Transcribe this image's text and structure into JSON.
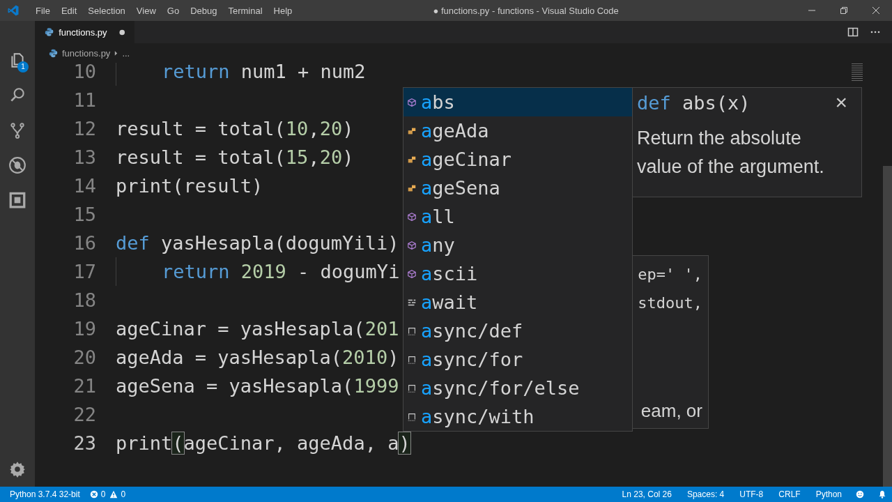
{
  "window": {
    "title": "● functions.py - functions - Visual Studio Code"
  },
  "menu": [
    "File",
    "Edit",
    "Selection",
    "View",
    "Go",
    "Debug",
    "Terminal",
    "Help"
  ],
  "activity_bar": {
    "explorer_badge": "1"
  },
  "tabs": [
    {
      "label": "functions.py",
      "selected": true,
      "modified": true
    }
  ],
  "breadcrumb": [
    "functions.py",
    "..."
  ],
  "editor": {
    "lines": [
      {
        "number": "10",
        "indent": true,
        "current": false,
        "tokens": [
          {
            "text": "return",
            "kind": "keyword"
          },
          {
            "text": " num1 + num2",
            "kind": "plain"
          }
        ]
      },
      {
        "number": "11",
        "current": false
      },
      {
        "number": "12",
        "indent": false,
        "current": false,
        "tokens": [
          {
            "text": "result = total(",
            "kind": "plain"
          },
          {
            "text": "10",
            "kind": "number"
          },
          {
            "text": ",",
            "kind": "plain"
          },
          {
            "text": "20",
            "kind": "number"
          },
          {
            "text": ")",
            "kind": "plain"
          }
        ]
      },
      {
        "number": "13",
        "indent": false,
        "current": false,
        "tokens": [
          {
            "text": "result = total(",
            "kind": "plain"
          },
          {
            "text": "15",
            "kind": "number"
          },
          {
            "text": ",",
            "kind": "plain"
          },
          {
            "text": "20",
            "kind": "number"
          },
          {
            "text": ")",
            "kind": "plain"
          }
        ]
      },
      {
        "number": "14",
        "indent": false,
        "current": false,
        "tokens": [
          {
            "text": "print(result)",
            "kind": "plain"
          }
        ]
      },
      {
        "number": "15",
        "current": false
      },
      {
        "number": "16",
        "indent": false,
        "current": false,
        "tokens": [
          {
            "text": "def",
            "kind": "keyword"
          },
          {
            "text": " yasHesapla(dogumYili)",
            "kind": "plain"
          }
        ]
      },
      {
        "number": "17",
        "indent": true,
        "current": false,
        "tokens": [
          {
            "text": "return",
            "kind": "keyword"
          },
          {
            "text": " 2019",
            "kind": "number"
          },
          {
            "text": " - dogumYi",
            "kind": "plain"
          }
        ]
      },
      {
        "number": "18",
        "current": false
      },
      {
        "number": "19",
        "indent": false,
        "current": false,
        "tokens": [
          {
            "text": "ageCinar = yasHesapla(",
            "kind": "plain"
          },
          {
            "text": "201",
            "kind": "number"
          }
        ]
      },
      {
        "number": "20",
        "indent": false,
        "current": false,
        "tokens": [
          {
            "text": "ageAda = yasHesapla(",
            "kind": "plain"
          },
          {
            "text": "2010",
            "kind": "number"
          },
          {
            "text": ")",
            "kind": "plain"
          }
        ]
      },
      {
        "number": "21",
        "indent": false,
        "current": false,
        "tokens": [
          {
            "text": "ageSena = yasHesapla(",
            "kind": "plain"
          },
          {
            "text": "1999",
            "kind": "number"
          }
        ]
      },
      {
        "number": "22",
        "current": false
      },
      {
        "number": "23",
        "indent": false,
        "current": true,
        "tokens": [
          {
            "text": "print",
            "kind": "plain"
          },
          {
            "text": "(",
            "kind": "bracket-match"
          },
          {
            "text": "ageCinar, ageAda, a",
            "kind": "plain"
          },
          {
            "text": ")",
            "kind": "bracket-match"
          }
        ]
      }
    ]
  },
  "suggestions": [
    {
      "label": "abs",
      "kind": "function",
      "selected": true
    },
    {
      "label": "ageAda",
      "kind": "variable",
      "selected": false
    },
    {
      "label": "ageCinar",
      "kind": "variable",
      "selected": false
    },
    {
      "label": "ageSena",
      "kind": "variable",
      "selected": false
    },
    {
      "label": "all",
      "kind": "function",
      "selected": false
    },
    {
      "label": "any",
      "kind": "function",
      "selected": false
    },
    {
      "label": "ascii",
      "kind": "function",
      "selected": false
    },
    {
      "label": "await",
      "kind": "keyword",
      "selected": false
    },
    {
      "label": "async/def",
      "kind": "snippet",
      "selected": false
    },
    {
      "label": "async/for",
      "kind": "snippet",
      "selected": false
    },
    {
      "label": "async/for/else",
      "kind": "snippet",
      "selected": false
    },
    {
      "label": "async/with",
      "kind": "snippet",
      "selected": false
    }
  ],
  "doc": {
    "keyword": "def",
    "signature": "abs(x)",
    "close": "×",
    "text": "Return the absolute value of the argument."
  },
  "parameter_hint": [
    "ep=' ',",
    "stdout,",
    "eam, or"
  ],
  "status_bar": {
    "interpreter": "Python 3.7.4 32-bit",
    "errors": "0",
    "warnings": "0",
    "right": [
      "Ln 23, Col 26",
      "Spaces: 4",
      "UTF-8",
      "CRLF",
      "Python"
    ]
  }
}
